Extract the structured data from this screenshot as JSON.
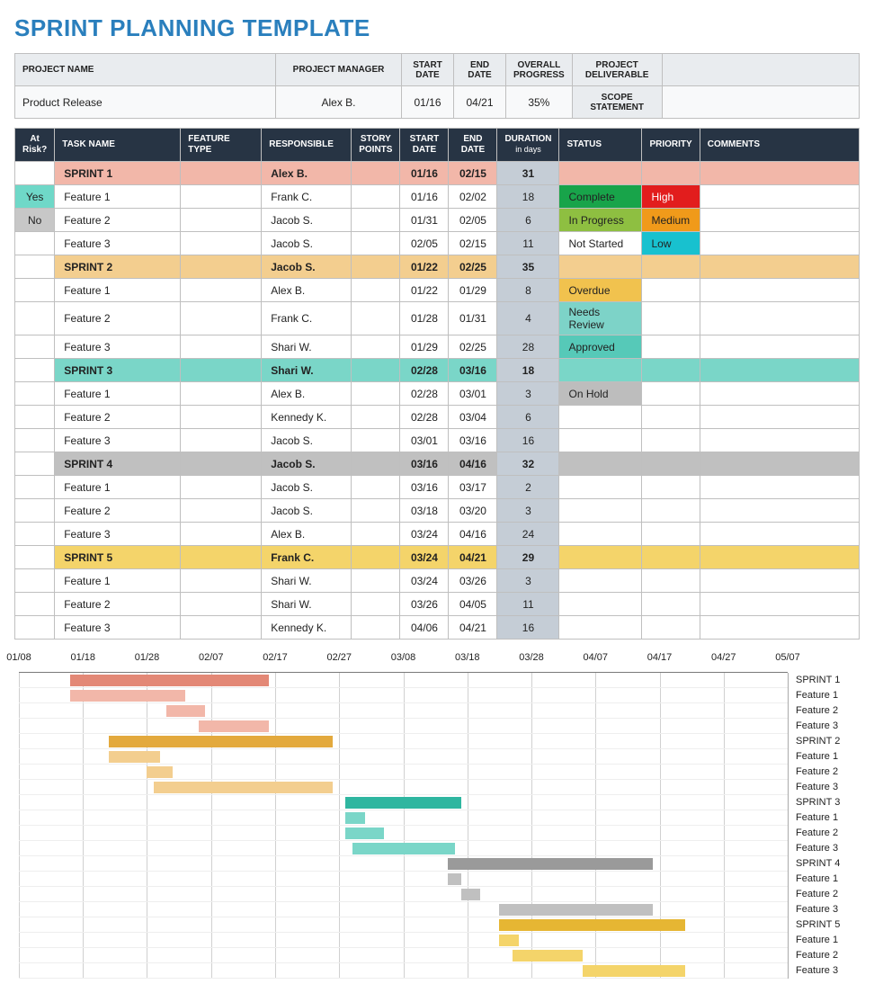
{
  "title": "SPRINT PLANNING TEMPLATE",
  "meta": {
    "headers": {
      "project_name": "PROJECT NAME",
      "project_manager": "PROJECT MANAGER",
      "start_date": "START DATE",
      "end_date": "END DATE",
      "overall_progress": "OVERALL PROGRESS",
      "project_deliverable": "PROJECT DELIVERABLE",
      "scope_statement": "SCOPE STATEMENT"
    },
    "values": {
      "project_name": "Product Release",
      "project_manager": "Alex B.",
      "start_date": "01/16",
      "end_date": "04/21",
      "overall_progress": "35%",
      "project_deliverable": "",
      "scope_statement": ""
    }
  },
  "grid_headers": {
    "risk": "At Risk?",
    "task": "TASK NAME",
    "feature": "FEATURE TYPE",
    "resp": "RESPONSIBLE",
    "story": "STORY POINTS",
    "start": "START DATE",
    "end": "END DATE",
    "duration": "DURATION",
    "duration_sub": "in days",
    "status": "STATUS",
    "priority": "PRIORITY",
    "comments": "COMMENTS"
  },
  "rows": [
    {
      "type": "sprint",
      "sprint": "s1",
      "risk": "",
      "task": "SPRINT 1",
      "resp": "Alex B.",
      "start": "01/16",
      "end": "02/15",
      "dur": "31",
      "status": "",
      "priority": ""
    },
    {
      "type": "task",
      "sprint": "s1",
      "risk": "Yes",
      "task": "Feature 1",
      "resp": "Frank C.",
      "start": "01/16",
      "end": "02/02",
      "dur": "18",
      "status": "Complete",
      "status_cls": "complete",
      "priority": "High",
      "pri_cls": "high"
    },
    {
      "type": "task",
      "sprint": "s1",
      "risk": "No",
      "task": "Feature 2",
      "resp": "Jacob S.",
      "start": "01/31",
      "end": "02/05",
      "dur": "6",
      "status": "In Progress",
      "status_cls": "inprogress",
      "priority": "Medium",
      "pri_cls": "medium"
    },
    {
      "type": "task",
      "sprint": "s1",
      "risk": "",
      "task": "Feature 3",
      "resp": "Jacob S.",
      "start": "02/05",
      "end": "02/15",
      "dur": "11",
      "status": "Not Started",
      "status_cls": "notstarted",
      "priority": "Low",
      "pri_cls": "low"
    },
    {
      "type": "sprint",
      "sprint": "s2",
      "risk": "",
      "task": "SPRINT 2",
      "resp": "Jacob S.",
      "start": "01/22",
      "end": "02/25",
      "dur": "35",
      "status": "",
      "priority": ""
    },
    {
      "type": "task",
      "sprint": "s2",
      "risk": "",
      "task": "Feature 1",
      "resp": "Alex B.",
      "start": "01/22",
      "end": "01/29",
      "dur": "8",
      "status": "Overdue",
      "status_cls": "overdue",
      "priority": "",
      "pri_cls": ""
    },
    {
      "type": "task",
      "sprint": "s2",
      "risk": "",
      "task": "Feature 2",
      "resp": "Frank C.",
      "start": "01/28",
      "end": "01/31",
      "dur": "4",
      "status": "Needs Review",
      "status_cls": "needsreview",
      "priority": "",
      "pri_cls": ""
    },
    {
      "type": "task",
      "sprint": "s2",
      "risk": "",
      "task": "Feature 3",
      "resp": "Shari W.",
      "start": "01/29",
      "end": "02/25",
      "dur": "28",
      "status": "Approved",
      "status_cls": "approved",
      "priority": "",
      "pri_cls": ""
    },
    {
      "type": "sprint",
      "sprint": "s3",
      "risk": "",
      "task": "SPRINT 3",
      "resp": "Shari W.",
      "start": "02/28",
      "end": "03/16",
      "dur": "18",
      "status": "",
      "priority": ""
    },
    {
      "type": "task",
      "sprint": "s3",
      "risk": "",
      "task": "Feature 1",
      "resp": "Alex B.",
      "start": "02/28",
      "end": "03/01",
      "dur": "3",
      "status": "On Hold",
      "status_cls": "onhold",
      "priority": "",
      "pri_cls": ""
    },
    {
      "type": "task",
      "sprint": "s3",
      "risk": "",
      "task": "Feature 2",
      "resp": "Kennedy K.",
      "start": "02/28",
      "end": "03/04",
      "dur": "6",
      "status": "",
      "status_cls": "",
      "priority": "",
      "pri_cls": ""
    },
    {
      "type": "task",
      "sprint": "s3",
      "risk": "",
      "task": "Feature 3",
      "resp": "Jacob S.",
      "start": "03/01",
      "end": "03/16",
      "dur": "16",
      "status": "",
      "status_cls": "",
      "priority": "",
      "pri_cls": ""
    },
    {
      "type": "sprint",
      "sprint": "s4",
      "risk": "",
      "task": "SPRINT 4",
      "resp": "Jacob S.",
      "start": "03/16",
      "end": "04/16",
      "dur": "32",
      "status": "",
      "priority": ""
    },
    {
      "type": "task",
      "sprint": "s4",
      "risk": "",
      "task": "Feature 1",
      "resp": "Jacob S.",
      "start": "03/16",
      "end": "03/17",
      "dur": "2",
      "status": "",
      "status_cls": "",
      "priority": "",
      "pri_cls": ""
    },
    {
      "type": "task",
      "sprint": "s4",
      "risk": "",
      "task": "Feature 2",
      "resp": "Jacob S.",
      "start": "03/18",
      "end": "03/20",
      "dur": "3",
      "status": "",
      "status_cls": "",
      "priority": "",
      "pri_cls": ""
    },
    {
      "type": "task",
      "sprint": "s4",
      "risk": "",
      "task": "Feature 3",
      "resp": "Alex B.",
      "start": "03/24",
      "end": "04/16",
      "dur": "24",
      "status": "",
      "status_cls": "",
      "priority": "",
      "pri_cls": ""
    },
    {
      "type": "sprint",
      "sprint": "s5",
      "risk": "",
      "task": "SPRINT 5",
      "resp": "Frank C.",
      "start": "03/24",
      "end": "04/21",
      "dur": "29",
      "status": "",
      "priority": ""
    },
    {
      "type": "task",
      "sprint": "s5",
      "risk": "",
      "task": "Feature 1",
      "resp": "Shari W.",
      "start": "03/24",
      "end": "03/26",
      "dur": "3",
      "status": "",
      "status_cls": "",
      "priority": "",
      "pri_cls": ""
    },
    {
      "type": "task",
      "sprint": "s5",
      "risk": "",
      "task": "Feature 2",
      "resp": "Shari W.",
      "start": "03/26",
      "end": "04/05",
      "dur": "11",
      "status": "",
      "status_cls": "",
      "priority": "",
      "pri_cls": ""
    },
    {
      "type": "task",
      "sprint": "s5",
      "risk": "",
      "task": "Feature 3",
      "resp": "Kennedy K.",
      "start": "04/06",
      "end": "04/21",
      "dur": "16",
      "status": "",
      "status_cls": "",
      "priority": "",
      "pri_cls": ""
    }
  ],
  "chart_data": {
    "type": "bar",
    "title": "",
    "xlabel": "",
    "ylabel": "",
    "x_ticks": [
      "01/08",
      "01/18",
      "01/28",
      "02/07",
      "02/17",
      "02/27",
      "03/08",
      "03/18",
      "03/28",
      "04/07",
      "04/17",
      "04/27",
      "05/07"
    ],
    "x_range_days": [
      0,
      120
    ],
    "origin_date": "01/08",
    "series": [
      {
        "name": "SPRINT 1",
        "start_day": 8,
        "dur": 31,
        "color": "c1d"
      },
      {
        "name": "Feature 1",
        "start_day": 8,
        "dur": 18,
        "color": "c1"
      },
      {
        "name": "Feature 2",
        "start_day": 23,
        "dur": 6,
        "color": "c1"
      },
      {
        "name": "Feature 3",
        "start_day": 28,
        "dur": 11,
        "color": "c1"
      },
      {
        "name": "SPRINT 2",
        "start_day": 14,
        "dur": 35,
        "color": "c2d"
      },
      {
        "name": "Feature 1",
        "start_day": 14,
        "dur": 8,
        "color": "c2"
      },
      {
        "name": "Feature 2",
        "start_day": 20,
        "dur": 4,
        "color": "c2"
      },
      {
        "name": "Feature 3",
        "start_day": 21,
        "dur": 28,
        "color": "c2"
      },
      {
        "name": "SPRINT 3",
        "start_day": 51,
        "dur": 18,
        "color": "c3d"
      },
      {
        "name": "Feature 1",
        "start_day": 51,
        "dur": 3,
        "color": "c3"
      },
      {
        "name": "Feature 2",
        "start_day": 51,
        "dur": 6,
        "color": "c3"
      },
      {
        "name": "Feature 3",
        "start_day": 52,
        "dur": 16,
        "color": "c3"
      },
      {
        "name": "SPRINT 4",
        "start_day": 67,
        "dur": 32,
        "color": "c4d"
      },
      {
        "name": "Feature 1",
        "start_day": 67,
        "dur": 2,
        "color": "c4"
      },
      {
        "name": "Feature 2",
        "start_day": 69,
        "dur": 3,
        "color": "c4"
      },
      {
        "name": "Feature 3",
        "start_day": 75,
        "dur": 24,
        "color": "c4"
      },
      {
        "name": "SPRINT 5",
        "start_day": 75,
        "dur": 29,
        "color": "c5d"
      },
      {
        "name": "Feature 1",
        "start_day": 75,
        "dur": 3,
        "color": "c5"
      },
      {
        "name": "Feature 2",
        "start_day": 77,
        "dur": 11,
        "color": "c5"
      },
      {
        "name": "Feature 3",
        "start_day": 88,
        "dur": 16,
        "color": "c5"
      }
    ]
  }
}
